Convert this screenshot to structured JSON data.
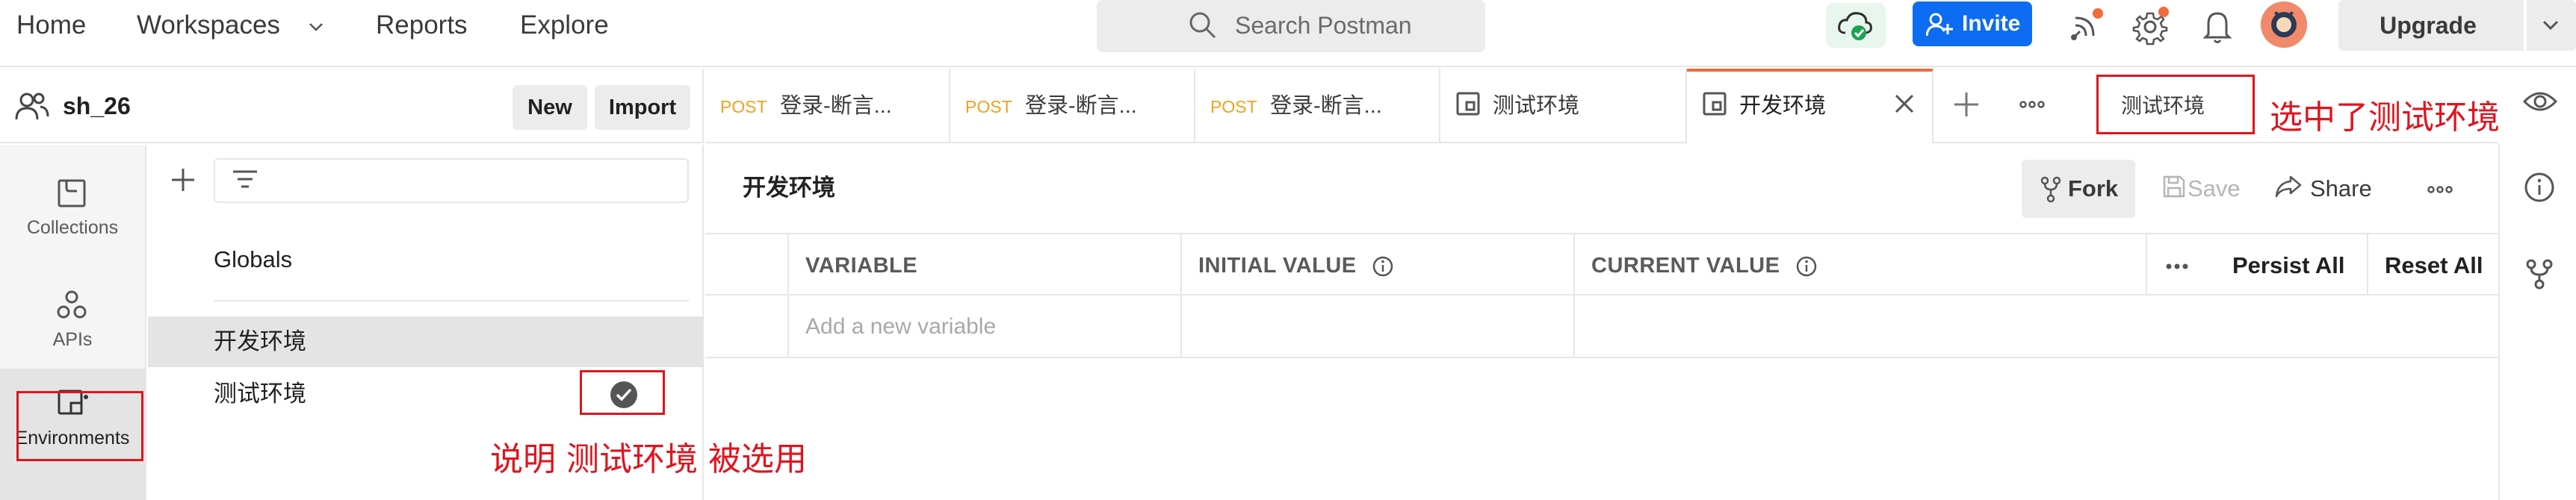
{
  "topbar": {
    "nav": [
      "Home",
      "Workspaces",
      "Reports",
      "Explore"
    ],
    "search_placeholder": "Search Postman",
    "invite_label": "Invite",
    "upgrade_label": "Upgrade",
    "colors": {
      "invite_bg": "#0c6cf2",
      "sync_ok": "#1aa351",
      "notification_dot": "#f26b3a"
    },
    "icons": [
      "search-icon",
      "cloud-sync-icon",
      "add-user-icon",
      "satellite-icon",
      "gear-icon",
      "bell-icon",
      "avatar",
      "chevron-down-icon"
    ]
  },
  "workspace": {
    "name": "sh_26",
    "new_label": "New",
    "import_label": "Import"
  },
  "rail": {
    "items": [
      {
        "label": "Collections",
        "icon": "collections-icon"
      },
      {
        "label": "APIs",
        "icon": "apis-icon"
      },
      {
        "label": "Environments",
        "icon": "environments-icon",
        "selected": true
      }
    ]
  },
  "sidebar": {
    "globals_label": "Globals",
    "environments": [
      {
        "name": "开发环境",
        "selected": true,
        "active": false
      },
      {
        "name": "测试环境",
        "selected": false,
        "active": true
      }
    ]
  },
  "tabs": [
    {
      "method": "POST",
      "name": "登录-断言..."
    },
    {
      "method": "POST",
      "name": "登录-断言..."
    },
    {
      "method": "POST",
      "name": "登录-断言..."
    },
    {
      "method": "",
      "name": "测试环境"
    },
    {
      "method": "",
      "name": "开发环境",
      "active": true
    }
  ],
  "env_selector": {
    "value": "测试环境"
  },
  "editor": {
    "title": "开发环境",
    "fork_label": "Fork",
    "save_label": "Save",
    "share_label": "Share",
    "columns": [
      "VARIABLE",
      "INITIAL VALUE",
      "CURRENT VALUE"
    ],
    "persist_all_label": "Persist All",
    "reset_all_label": "Reset All",
    "new_variable_placeholder": "Add a new variable"
  },
  "annotations": {
    "left": "说明 测试环境 被选用",
    "right": "选中了测试环境",
    "color": "#e0141e"
  }
}
